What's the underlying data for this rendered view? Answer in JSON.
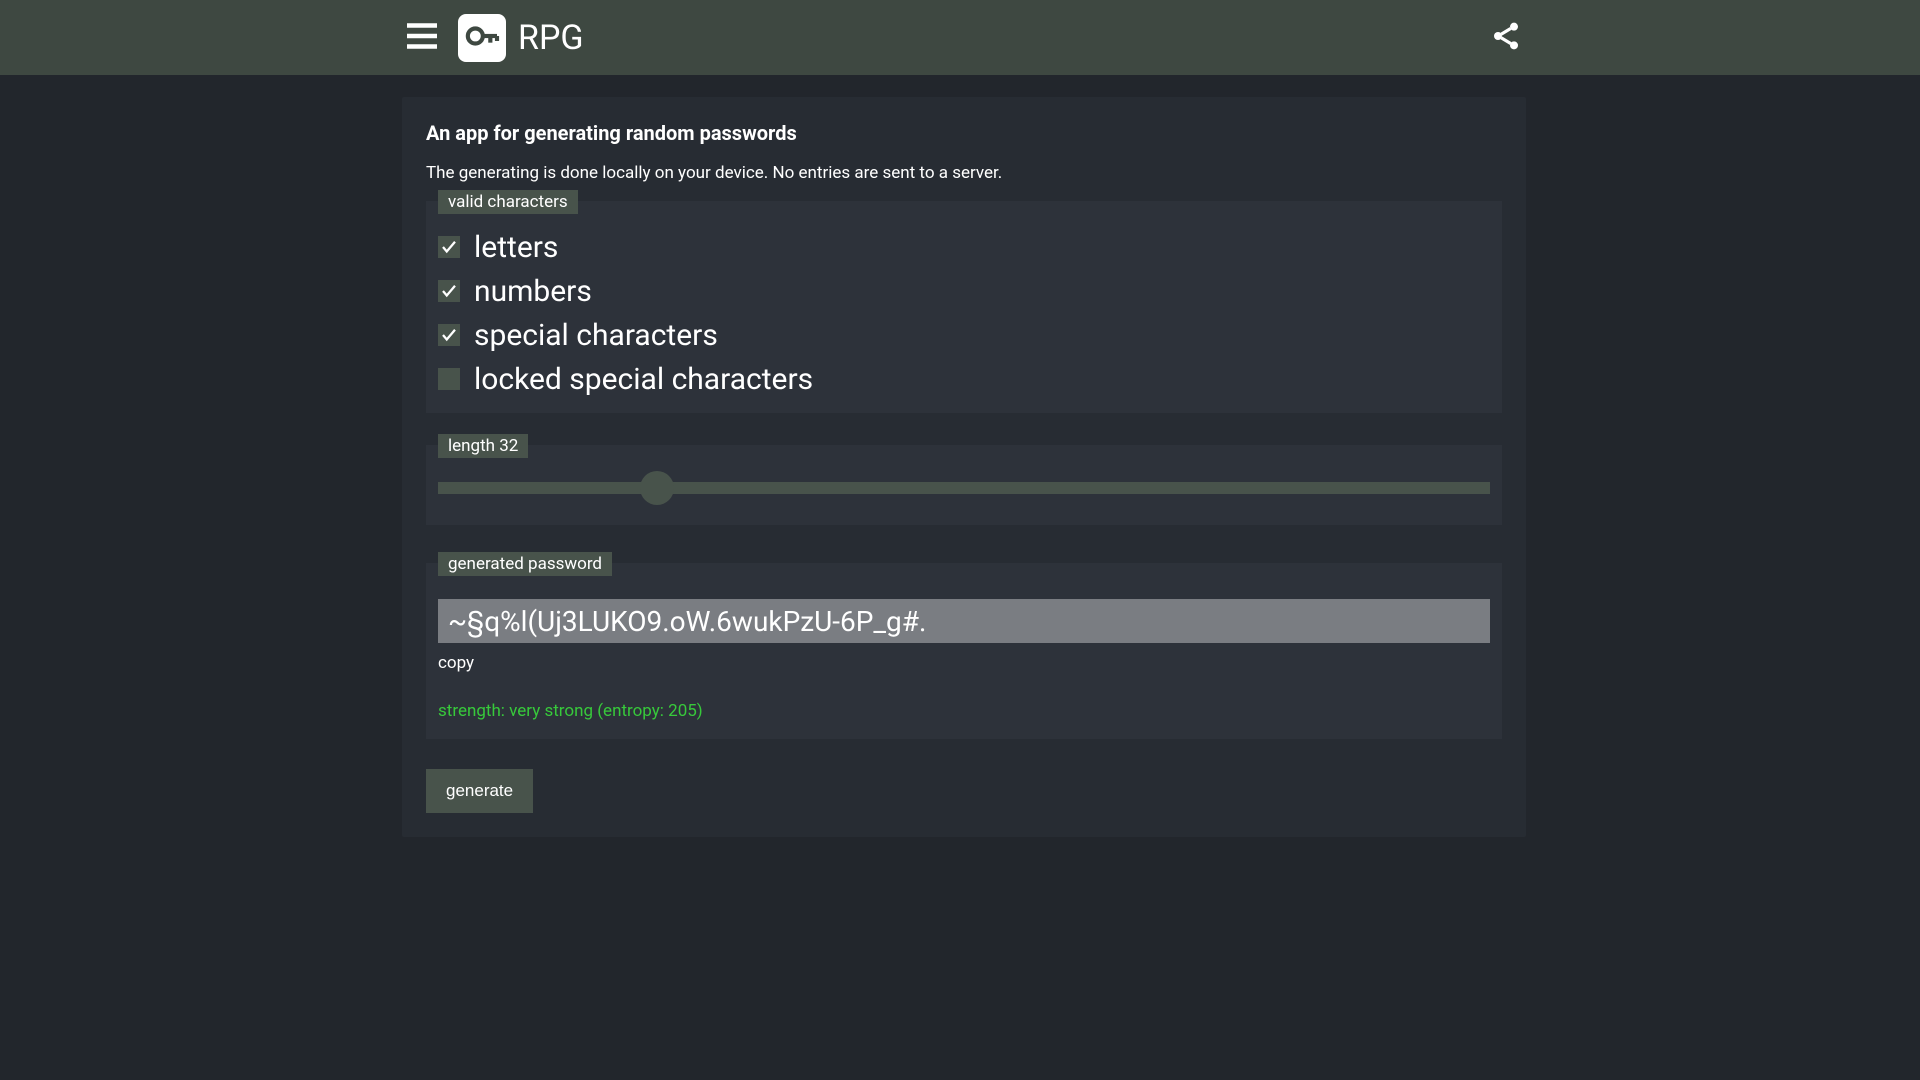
{
  "header": {
    "app_title": "RPG"
  },
  "card": {
    "title": "An app for generating random passwords",
    "description": "The generating is done locally on your device. No entries are sent to a server."
  },
  "valid_chars": {
    "tag": "valid characters",
    "options": [
      {
        "label": "letters",
        "checked": true
      },
      {
        "label": "numbers",
        "checked": true
      },
      {
        "label": "special characters",
        "checked": true
      },
      {
        "label": "locked special characters",
        "checked": false
      }
    ]
  },
  "length": {
    "tag_prefix": "length",
    "value": 32,
    "min": 1,
    "max": 150,
    "percent": 20.8
  },
  "generated": {
    "tag": "generated password",
    "value": "~§q%l(Uj3LUKO9.oW.6wukPzU-6P_g#.",
    "copy_label": "copy",
    "strength_prefix": "strength:",
    "strength_desc": "very strong",
    "entropy_label": "entropy:",
    "entropy_value": 205
  },
  "buttons": {
    "generate": "generate"
  }
}
